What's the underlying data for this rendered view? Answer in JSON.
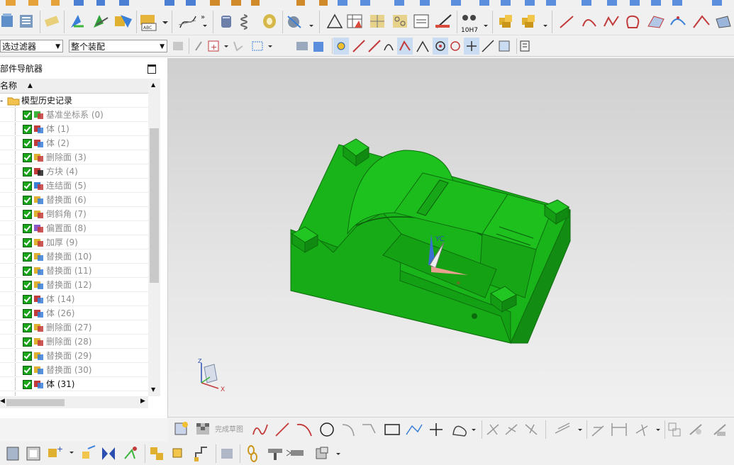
{
  "filters": {
    "selection_filter": "选过滤器",
    "scope": "整个装配"
  },
  "navigator": {
    "title": "部件导航器",
    "column_name": "名称",
    "root_label": "模型历史记录",
    "items": [
      {
        "label": "基准坐标系 (0)",
        "icon": "datum-csys-icon",
        "active": false
      },
      {
        "label": "体 (1)",
        "icon": "body-icon",
        "active": false
      },
      {
        "label": "体 (2)",
        "icon": "body-icon",
        "active": false
      },
      {
        "label": "删除面 (3)",
        "icon": "delete-face-icon",
        "active": false
      },
      {
        "label": "方块 (4)",
        "icon": "block-icon",
        "active": false
      },
      {
        "label": "连结面 (5)",
        "icon": "unite-face-icon",
        "active": false
      },
      {
        "label": "替换面 (6)",
        "icon": "replace-face-icon",
        "active": false
      },
      {
        "label": "倒斜角 (7)",
        "icon": "chamfer-icon",
        "active": false
      },
      {
        "label": "偏置面 (8)",
        "icon": "offset-face-icon",
        "active": false
      },
      {
        "label": "加厚 (9)",
        "icon": "thicken-icon",
        "active": false
      },
      {
        "label": "替换面 (10)",
        "icon": "replace-face-icon",
        "active": false
      },
      {
        "label": "替换面 (11)",
        "icon": "replace-face-icon",
        "active": false
      },
      {
        "label": "替换面 (12)",
        "icon": "replace-face-icon",
        "active": false
      },
      {
        "label": "体 (14)",
        "icon": "body-icon",
        "active": false
      },
      {
        "label": "体 (26)",
        "icon": "body-icon",
        "active": false
      },
      {
        "label": "删除面 (27)",
        "icon": "delete-face-icon",
        "active": false
      },
      {
        "label": "删除面 (28)",
        "icon": "delete-face-icon",
        "active": false
      },
      {
        "label": "替换面 (29)",
        "icon": "replace-face-icon",
        "active": false
      },
      {
        "label": "替换面 (30)",
        "icon": "replace-face-icon",
        "active": false
      },
      {
        "label": "体 (31)",
        "icon": "body-icon",
        "active": true
      }
    ]
  },
  "toolbar": {
    "tolerance_label": "10H7",
    "finish_sketch": "完成草图"
  },
  "viewport": {
    "triad_label": "YC",
    "triad_z": "Z",
    "triad_x": "X",
    "model_color": "#16b814"
  }
}
